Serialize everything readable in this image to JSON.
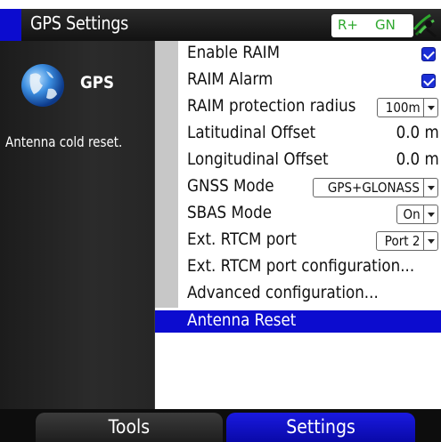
{
  "header": {
    "title": "GPS Settings",
    "status_rplus": "R+",
    "status_gn": "GN",
    "accent_color": "#0c0ccf",
    "status_icon": "satellite-icon"
  },
  "sidebar": {
    "device_icon": "globe-icon",
    "device_name": "GPS",
    "status_message": "Antenna cold reset."
  },
  "settings": {
    "rows": [
      {
        "label": "Enable RAIM",
        "control": "checkbox",
        "checked": true
      },
      {
        "label": "RAIM Alarm",
        "control": "checkbox",
        "checked": true
      },
      {
        "label": "RAIM protection radius",
        "control": "dropdown",
        "value": "100m"
      },
      {
        "label": "Latitudinal Offset",
        "control": "text",
        "value": "0.0 m"
      },
      {
        "label": "Longitudinal Offset",
        "control": "text",
        "value": "0.0 m"
      },
      {
        "label": "GNSS Mode",
        "control": "dropdown",
        "value": "GPS+GLONASS"
      },
      {
        "label": "SBAS Mode",
        "control": "dropdown",
        "value": "On"
      },
      {
        "label": "Ext. RTCM port",
        "control": "dropdown",
        "value": "Port 2"
      },
      {
        "label": "Ext. RTCM port configuration...",
        "control": "none"
      },
      {
        "label": "Advanced configuration...",
        "control": "none"
      },
      {
        "label": "Antenna Reset",
        "control": "none",
        "selected": true
      }
    ]
  },
  "tabs": [
    {
      "label": "Tools",
      "active": false
    },
    {
      "label": "Settings",
      "active": true
    }
  ]
}
